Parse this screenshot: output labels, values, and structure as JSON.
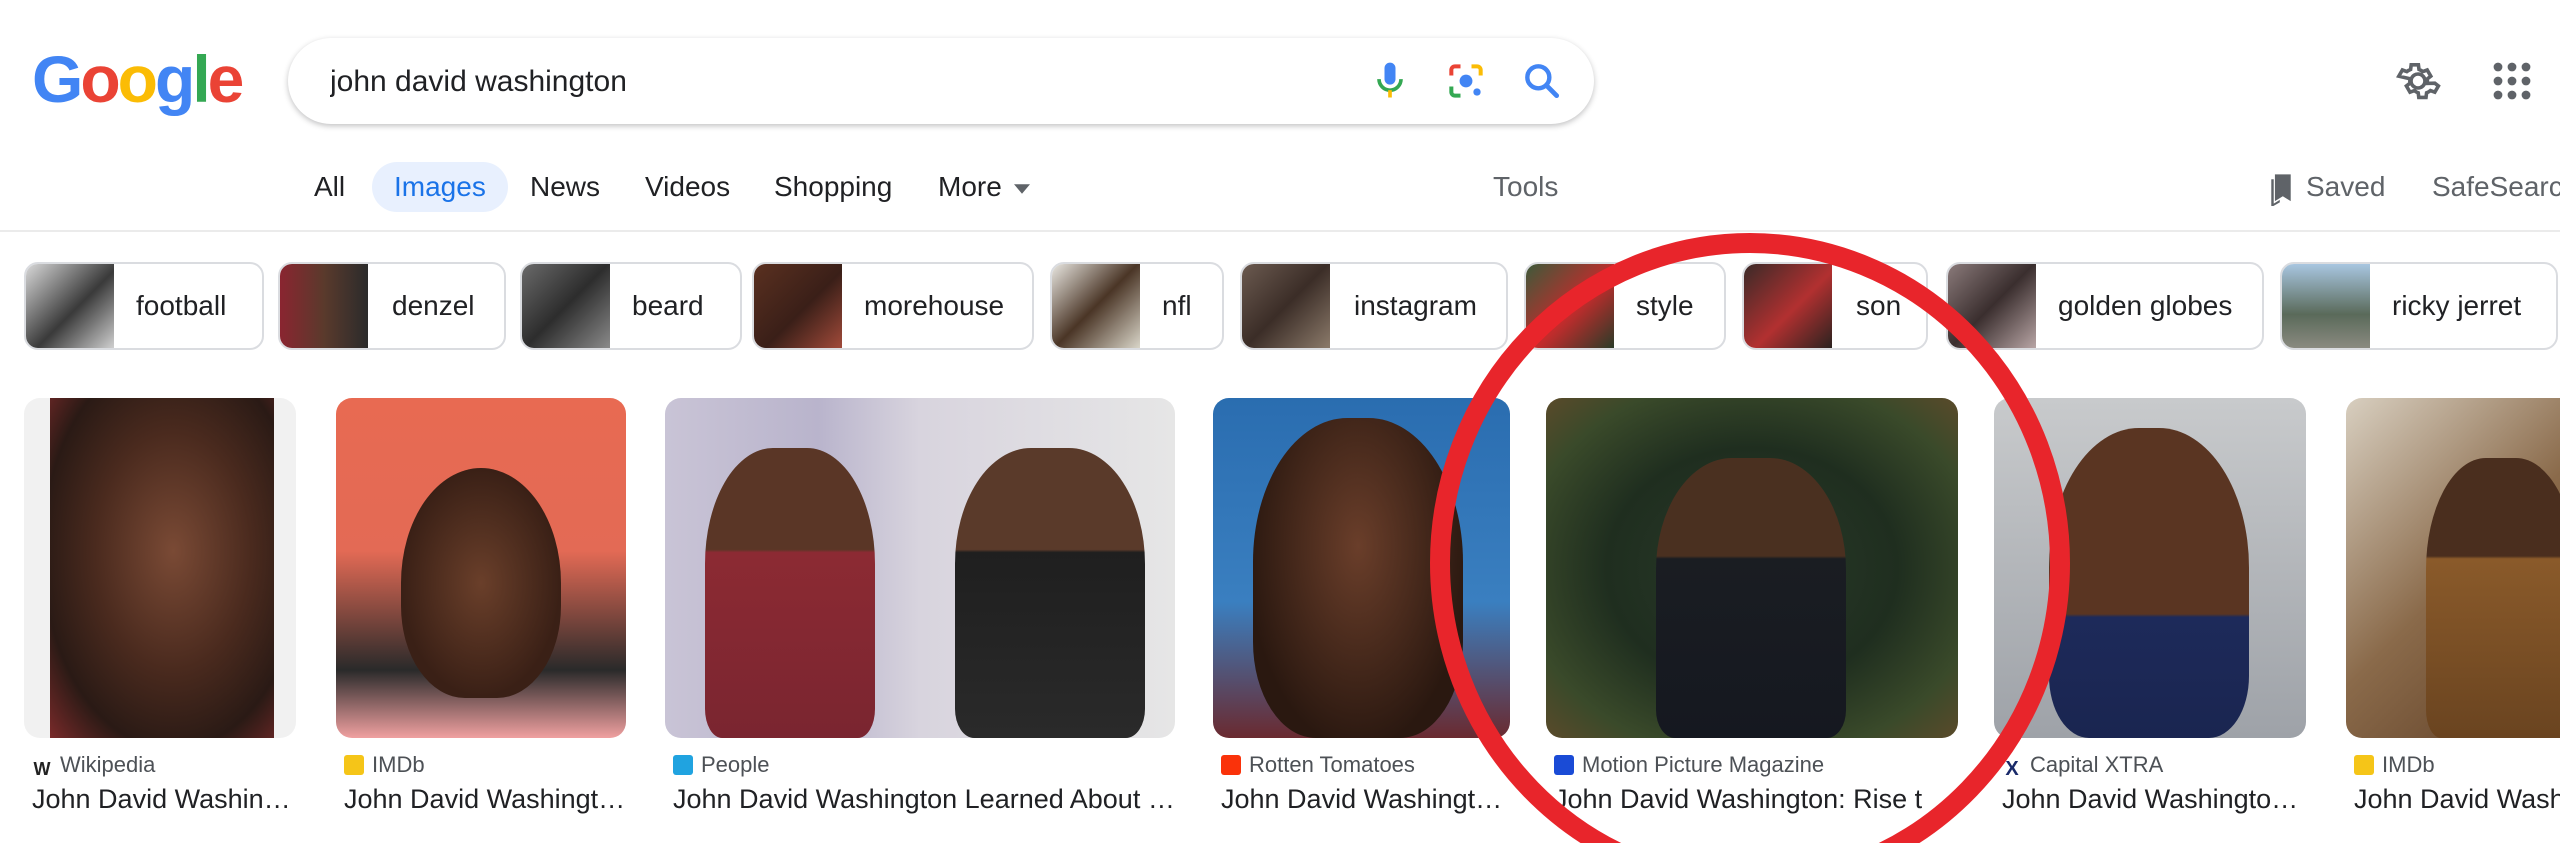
{
  "search": {
    "query": "john david washington"
  },
  "logo": {
    "letters": [
      "G",
      "o",
      "o",
      "g",
      "l",
      "e"
    ],
    "colors": [
      "#4285f4",
      "#ea4335",
      "#fbbc05",
      "#4285f4",
      "#34a853",
      "#ea4335"
    ]
  },
  "icons": {
    "mic": "microphone-icon",
    "lens": "google-lens-icon",
    "search": "search-icon",
    "settings": "gear-icon",
    "apps": "apps-grid-icon",
    "saved": "bookmark-icon"
  },
  "tabs": {
    "all": "All",
    "images": "Images",
    "news": "News",
    "videos": "Videos",
    "shopping": "Shopping",
    "more": "More",
    "tools": "Tools",
    "saved": "Saved",
    "safesearch": "SafeSearch"
  },
  "chips": [
    "football",
    "denzel",
    "beard",
    "morehouse",
    "nfl",
    "instagram",
    "style",
    "son",
    "golden globes",
    "ricky jerret"
  ],
  "results": [
    {
      "source": "Wikipedia",
      "title": "John David Washin…"
    },
    {
      "source": "IMDb",
      "title": "John David Washingt…"
    },
    {
      "source": "People",
      "title": "John David Washington Learned About …"
    },
    {
      "source": "Rotten Tomatoes",
      "title": "John David Washingt…"
    },
    {
      "source": "Motion Picture Magazine",
      "title": "John David Washington: Rise t"
    },
    {
      "source": "Capital XTRA",
      "title": "John David Washingto…"
    },
    {
      "source": "IMDb",
      "title": "John David Washi"
    }
  ],
  "annotation_color": "#e8252b"
}
